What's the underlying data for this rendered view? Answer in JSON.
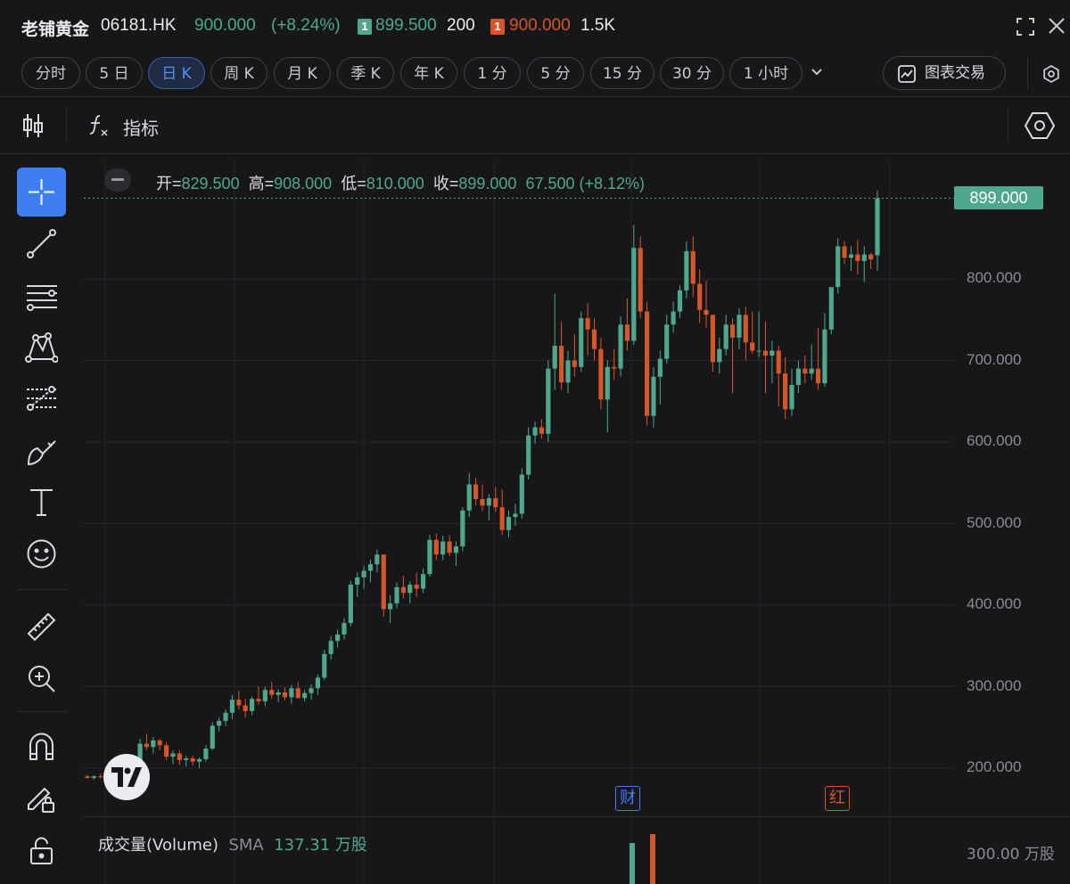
{
  "header": {
    "name": "老铺黄金",
    "code": "06181.HK",
    "price": "900.000",
    "change": "(+8.24%)",
    "bid_level": "1",
    "bid_price": "899.500",
    "bid_size": "200",
    "ask_level": "1",
    "ask_price": "900.000",
    "ask_size": "1.5K"
  },
  "colors": {
    "up": "#4fa88d",
    "down": "#d4562a",
    "accent": "#3f7ef0",
    "bg": "#17171a"
  },
  "tabs": [
    "分时",
    "5 日",
    "日 K",
    "周 K",
    "月 K",
    "季 K",
    "年 K",
    "1 分",
    "5 分",
    "15 分",
    "30 分",
    "1 小时"
  ],
  "active_tab": "日 K",
  "trade_button": "图表交易",
  "indicator_button": "指标",
  "icons": [
    "candlestick-icon",
    "function-icon",
    "hexagon-settings-icon",
    "crosshair-icon",
    "trend-line-icon",
    "parallel-lines-icon",
    "pattern-icon",
    "fib-icon",
    "brush-icon",
    "text-icon",
    "emoji-icon",
    "ruler-icon",
    "zoom-in-icon",
    "magnet-icon",
    "lock-edit-icon",
    "lock-icon"
  ],
  "ohlc": {
    "open_label": "开=",
    "open": "829.500",
    "high_label": "高=",
    "high": "908.000",
    "low_label": "低=",
    "low": "810.000",
    "close_label": "收=",
    "close": "899.000",
    "change": "67.500",
    "change_pct": "(+8.12%)"
  },
  "last_price_label": "899.000",
  "y_axis_labels": [
    "800.000",
    "700.000",
    "600.000",
    "500.000",
    "400.000",
    "300.000",
    "200.000"
  ],
  "markers": {
    "earnings": "财",
    "dividend": "红"
  },
  "volume": {
    "title": "成交量(Volume)",
    "sma_label": "SMA",
    "sma_value": "137.31 万股",
    "scale_label": "300.00 万股"
  },
  "chart_data": {
    "type": "candlestick",
    "ylim": [
      165,
      930
    ],
    "candles": [
      [
        190,
        192,
        187,
        188
      ],
      [
        188,
        191,
        186,
        190
      ],
      [
        190,
        193,
        187,
        189
      ],
      [
        189,
        192,
        185,
        186
      ],
      [
        186,
        189,
        182,
        187
      ],
      [
        187,
        192,
        185,
        190
      ],
      [
        190,
        196,
        188,
        194
      ],
      [
        194,
        212,
        191,
        208
      ],
      [
        208,
        236,
        205,
        230
      ],
      [
        230,
        242,
        222,
        226
      ],
      [
        226,
        238,
        218,
        234
      ],
      [
        234,
        236,
        222,
        228
      ],
      [
        228,
        232,
        210,
        214
      ],
      [
        214,
        222,
        205,
        218
      ],
      [
        218,
        222,
        204,
        210
      ],
      [
        210,
        215,
        202,
        212
      ],
      [
        212,
        216,
        203,
        208
      ],
      [
        208,
        213,
        200,
        211
      ],
      [
        211,
        228,
        208,
        224
      ],
      [
        224,
        256,
        222,
        252
      ],
      [
        252,
        262,
        245,
        258
      ],
      [
        258,
        272,
        252,
        268
      ],
      [
        268,
        290,
        260,
        284
      ],
      [
        284,
        295,
        272,
        277
      ],
      [
        277,
        285,
        262,
        270
      ],
      [
        270,
        288,
        265,
        285
      ],
      [
        285,
        300,
        278,
        282
      ],
      [
        282,
        300,
        276,
        296
      ],
      [
        296,
        306,
        285,
        290
      ],
      [
        290,
        297,
        281,
        293
      ],
      [
        293,
        299,
        283,
        287
      ],
      [
        287,
        302,
        279,
        298
      ],
      [
        298,
        306,
        285,
        286
      ],
      [
        286,
        296,
        282,
        292
      ],
      [
        292,
        303,
        284,
        298
      ],
      [
        298,
        315,
        290,
        311
      ],
      [
        311,
        345,
        308,
        340
      ],
      [
        340,
        362,
        333,
        356
      ],
      [
        356,
        370,
        348,
        364
      ],
      [
        364,
        384,
        358,
        378
      ],
      [
        378,
        430,
        374,
        425
      ],
      [
        425,
        440,
        410,
        434
      ],
      [
        434,
        448,
        420,
        442
      ],
      [
        442,
        456,
        428,
        450
      ],
      [
        450,
        468,
        440,
        462
      ],
      [
        462,
        452,
        386,
        395
      ],
      [
        395,
        412,
        378,
        402
      ],
      [
        402,
        428,
        396,
        422
      ],
      [
        422,
        436,
        408,
        415
      ],
      [
        415,
        429,
        402,
        425
      ],
      [
        425,
        440,
        410,
        420
      ],
      [
        420,
        445,
        415,
        438
      ],
      [
        438,
        486,
        435,
        480
      ],
      [
        480,
        488,
        455,
        462
      ],
      [
        462,
        485,
        455,
        478
      ],
      [
        478,
        486,
        460,
        464
      ],
      [
        464,
        478,
        448,
        472
      ],
      [
        472,
        520,
        466,
        516
      ],
      [
        516,
        562,
        508,
        548
      ],
      [
        548,
        556,
        522,
        530
      ],
      [
        530,
        548,
        515,
        522
      ],
      [
        522,
        536,
        504,
        531
      ],
      [
        531,
        545,
        514,
        520
      ],
      [
        520,
        542,
        486,
        492
      ],
      [
        492,
        516,
        483,
        508
      ],
      [
        508,
        524,
        497,
        512
      ],
      [
        512,
        568,
        506,
        560
      ],
      [
        560,
        618,
        554,
        608
      ],
      [
        608,
        625,
        598,
        618
      ],
      [
        618,
        628,
        604,
        610
      ],
      [
        610,
        700,
        600,
        690
      ],
      [
        690,
        782,
        664,
        718
      ],
      [
        718,
        748,
        664,
        673
      ],
      [
        673,
        712,
        660,
        700
      ],
      [
        700,
        732,
        680,
        692
      ],
      [
        692,
        760,
        686,
        752
      ],
      [
        752,
        770,
        706,
        738
      ],
      [
        738,
        752,
        700,
        714
      ],
      [
        714,
        728,
        640,
        652
      ],
      [
        652,
        700,
        612,
        692
      ],
      [
        692,
        714,
        676,
        690
      ],
      [
        690,
        754,
        680,
        744
      ],
      [
        744,
        776,
        712,
        724
      ],
      [
        724,
        866,
        719,
        838
      ],
      [
        838,
        852,
        752,
        760
      ],
      [
        760,
        772,
        620,
        632
      ],
      [
        632,
        692,
        618,
        680
      ],
      [
        680,
        712,
        646,
        702
      ],
      [
        702,
        756,
        696,
        744
      ],
      [
        744,
        772,
        734,
        760
      ],
      [
        760,
        792,
        752,
        786
      ],
      [
        786,
        846,
        776,
        834
      ],
      [
        834,
        852,
        778,
        794
      ],
      [
        794,
        812,
        746,
        762
      ],
      [
        762,
        798,
        740,
        756
      ],
      [
        756,
        748,
        686,
        698
      ],
      [
        698,
        728,
        684,
        714
      ],
      [
        714,
        756,
        706,
        744
      ],
      [
        744,
        752,
        660,
        728
      ],
      [
        728,
        764,
        714,
        756
      ],
      [
        756,
        766,
        700,
        722
      ],
      [
        722,
        760,
        708,
        712
      ],
      [
        712,
        760,
        704,
        712
      ],
      [
        712,
        748,
        660,
        706
      ],
      [
        706,
        724,
        672,
        712
      ],
      [
        712,
        718,
        644,
        684
      ],
      [
        684,
        704,
        628,
        640
      ],
      [
        640,
        690,
        632,
        670
      ],
      [
        670,
        700,
        660,
        690
      ],
      [
        690,
        706,
        672,
        684
      ],
      [
        684,
        720,
        676,
        690
      ],
      [
        690,
        740,
        664,
        672
      ],
      [
        672,
        758,
        668,
        738
      ],
      [
        738,
        782,
        732,
        790
      ],
      [
        790,
        850,
        782,
        840
      ],
      [
        840,
        846,
        818,
        826
      ],
      [
        826,
        840,
        810,
        830
      ],
      [
        830,
        848,
        806,
        822
      ],
      [
        822,
        840,
        796,
        830
      ],
      [
        830,
        832,
        812,
        824
      ],
      [
        829,
        908,
        810,
        899
      ]
    ],
    "y_ticks": [
      200,
      300,
      400,
      500,
      600,
      700,
      800
    ]
  }
}
